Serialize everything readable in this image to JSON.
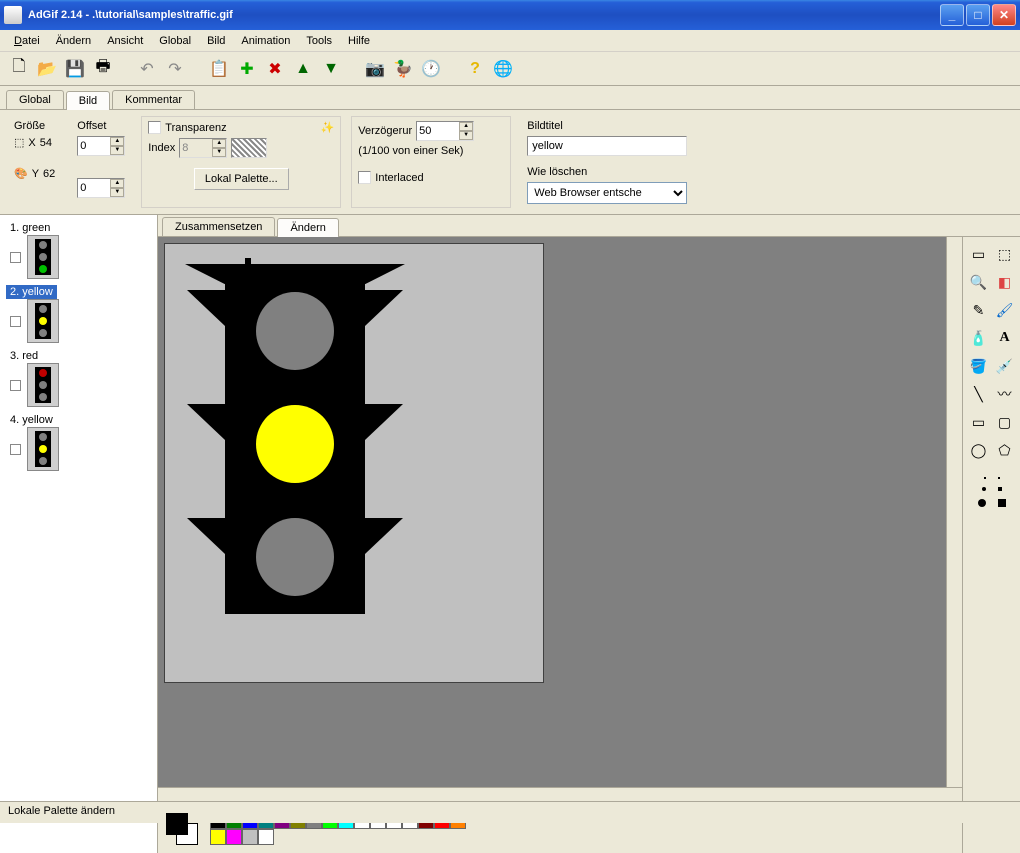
{
  "title": "AdGif 2.14 - .\\tutorial\\samples\\traffic.gif",
  "menu": {
    "datei": "Datei",
    "aendern": "Ändern",
    "ansicht": "Ansicht",
    "global": "Global",
    "bild": "Bild",
    "animation": "Animation",
    "tools": "Tools",
    "hilfe": "Hilfe"
  },
  "main_tabs": {
    "global": "Global",
    "bild": "Bild",
    "kommentar": "Kommentar"
  },
  "panel": {
    "groesse_label": "Größe",
    "offset_label": "Offset",
    "x_label": "X",
    "x_value": "54",
    "y_label": "Y",
    "y_value": "62",
    "offset_x": "0",
    "offset_y": "0",
    "transparenz": "Transparenz",
    "index_label": "Index",
    "index_value": "8",
    "lokal_palette": "Lokal Palette...",
    "verzoegerung_label": "Verzögerur",
    "verzoegerung_value": "50",
    "verzoegerung_hint": "(1/100 von einer Sek)",
    "interlaced": "Interlaced",
    "bildtitel_label": "Bildtitel",
    "bildtitel_value": "yellow",
    "loeschen_label": "Wie löschen",
    "loeschen_value": "Web Browser entsche"
  },
  "editor_tabs": {
    "zusammensetzen": "Zusammensetzen",
    "aendern": "Ändern"
  },
  "frames": [
    {
      "label": "1. green",
      "lights": [
        "#808080",
        "#808080",
        "#00c000"
      ]
    },
    {
      "label": "2. yellow",
      "lights": [
        "#808080",
        "#ffff00",
        "#808080"
      ],
      "selected": true
    },
    {
      "label": "3. red",
      "lights": [
        "#c00000",
        "#808080",
        "#808080"
      ]
    },
    {
      "label": "4. yellow",
      "lights": [
        "#808080",
        "#ffff00",
        "#808080"
      ]
    }
  ],
  "palette": [
    "#000000",
    "#008000",
    "#0000ff",
    "#008080",
    "#800080",
    "#808000",
    "#808080",
    "#00ff00",
    "#00ffff",
    "#ffffff",
    "#ffffff",
    "#ffffff",
    "#ffffff",
    "#800000",
    "#ff0000",
    "#ff8000",
    "#ffff00",
    "#ff00ff",
    "#c0c0c0",
    "#ffffff"
  ],
  "status": "Lokale Palette ändern"
}
